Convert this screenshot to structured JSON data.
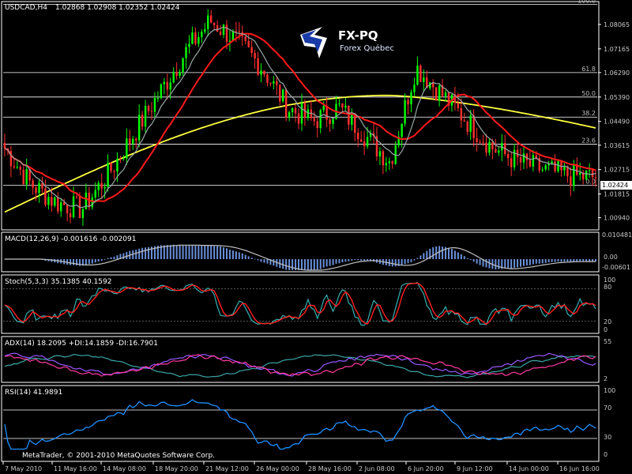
{
  "window": {
    "symbol_title": "USDCAD,H4",
    "ohlc": "1.02868 1.02908 1.02352 1.02424",
    "footer": "MetaTrader, © 2001-2010 MetaQuotes Software Corp."
  },
  "logo": {
    "name": "FX-PQ",
    "sub": "Forex Québec"
  },
  "colors": {
    "bull_candle": "#00ff00",
    "bear_candle": "#ff3030",
    "ma_fast": "#9aa7a7",
    "ma_mid": "#ff1a1a",
    "ma_slow": "#ffff40",
    "macd_hist": "#6a8fd8",
    "macd_signal": "#c0c0c0",
    "stoch_main": "#36b0b0",
    "stoch_signal": "#ff2020",
    "adx_main": "#3aa6a6",
    "adx_plus": "#9b57ff",
    "adx_minus": "#ff3aa0",
    "rsi": "#1e90ff",
    "fib": "#ffffff",
    "current_price_tag": "#ffffff"
  },
  "fib_levels": [
    {
      "label": "100.0",
      "price": 1.0881
    },
    {
      "label": "61.8",
      "price": 1.0629
    },
    {
      "label": "50.0",
      "price": 1.0539
    },
    {
      "label": "38.2",
      "price": 1.0465
    },
    {
      "label": "23.6",
      "price": 1.0365
    },
    {
      "label": "0.0",
      "price": 1.0214
    }
  ],
  "main_pane": {
    "price_axis": [
      "1.08065",
      "1.07165",
      "1.06290",
      "1.05390",
      "1.04490",
      "1.03615",
      "1.02715",
      "1.01815",
      "1.00940"
    ],
    "current_price": "1.02424",
    "y_range": [
      1.0055,
      1.0885
    ]
  },
  "indicators": {
    "macd": {
      "label": "MACD(12,26,9) -0.001616 -0.002091",
      "axis": [
        "0.010481",
        "0.00",
        "-0.00601"
      ]
    },
    "stoch": {
      "label": "Stoch(5,3,3) 35.1385 40.1592",
      "axis": [
        "100",
        "80",
        "20",
        "0"
      ]
    },
    "adx": {
      "label": "ADX(14) 18.2095 +DI:14.1859 -DI:16.7901",
      "axis": [
        "55",
        "2"
      ]
    },
    "rsi": {
      "label": "RSI(14) 41.9891",
      "axis": [
        "100",
        "70",
        "30",
        "0"
      ]
    }
  },
  "time_axis": [
    "7 May 2010",
    "11 May 16:00",
    "14 May 08:00",
    "18 May 20:00",
    "21 May 12:00",
    "26 May 00:00",
    "28 May 16:00",
    "2 Jun 08:00",
    "6 Jun 20:00",
    "9 Jun 12:00",
    "14 Jun 00:00",
    "16 Jun 16:00"
  ],
  "chart_data": {
    "type": "line",
    "title": "USDCAD,H4",
    "key_close_path": [
      1.035,
      1.022,
      1.015,
      1.0125,
      1.025,
      1.04,
      1.055,
      1.07,
      1.082,
      1.075,
      1.065,
      1.05,
      1.045,
      1.05,
      1.04,
      1.03,
      1.065,
      1.055,
      1.045,
      1.035,
      1.03,
      1.027,
      1.025,
      1.0242
    ],
    "ylim": [
      1.0055,
      1.0885
    ]
  }
}
